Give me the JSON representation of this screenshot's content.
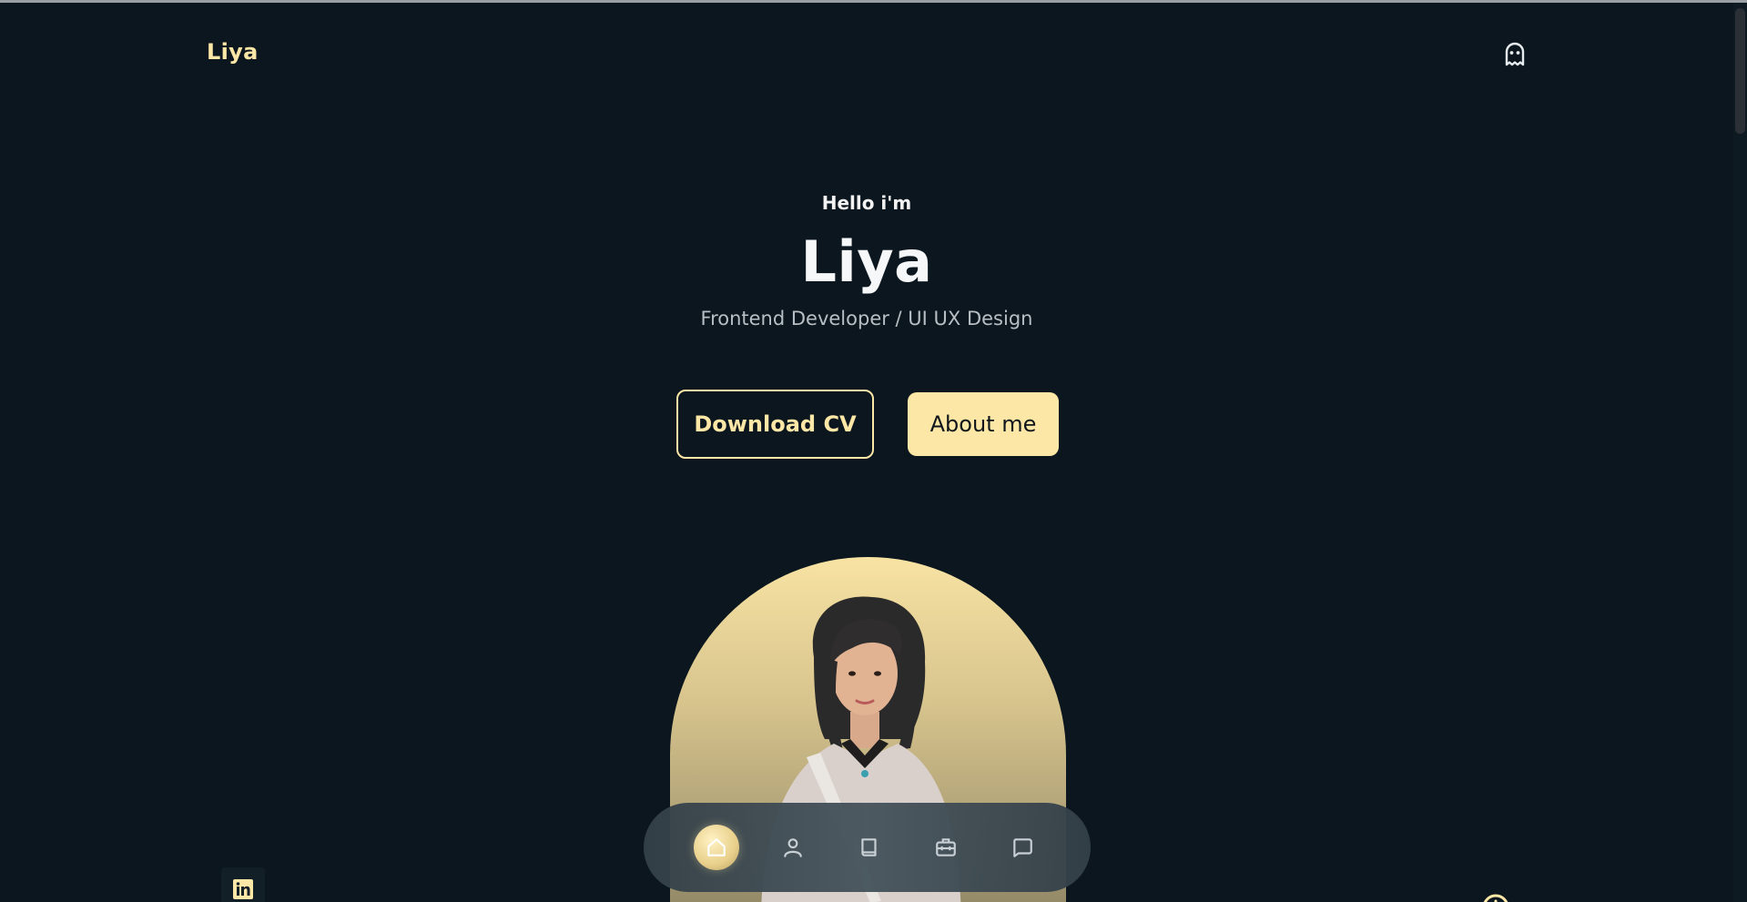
{
  "header": {
    "logo": "Liya",
    "theme_toggle_icon": "ghost-icon"
  },
  "hero": {
    "greeting": "Hello i'm",
    "name": "Liya",
    "role": "Frontend Developer / UI UX Design",
    "download_cv_label": "Download CV",
    "about_me_label": "About me",
    "portrait_alt": "portrait photo"
  },
  "bottom_nav": {
    "items": [
      {
        "icon": "home-icon",
        "active": true
      },
      {
        "icon": "user-icon",
        "active": false
      },
      {
        "icon": "book-icon",
        "active": false
      },
      {
        "icon": "briefcase-icon",
        "active": false
      },
      {
        "icon": "message-icon",
        "active": false
      }
    ]
  },
  "socials": {
    "linkedin_icon": "linkedin-icon"
  },
  "colors": {
    "background": "#0b161e",
    "accent": "#fde7a6",
    "text_muted": "#b8bfc4"
  }
}
